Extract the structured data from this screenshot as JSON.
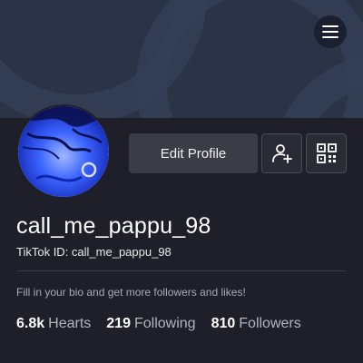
{
  "header": {
    "menu_icon": "hamburger-menu-icon"
  },
  "profile": {
    "avatar_icon": "profile-photo",
    "username": "call_me_pappu_98",
    "tiktok_id": "TikTok ID: call_me_pappu_98",
    "bio_prompt": "Fill in your bio and get more followers and likes!"
  },
  "actions": {
    "edit_profile_label": "Edit Profile",
    "add_friend_icon": "add-friend-icon",
    "qr_code_icon": "qr-code-icon"
  },
  "stats": [
    {
      "value": "6.8k",
      "label": "Hearts"
    },
    {
      "value": "219",
      "label": "Following"
    },
    {
      "value": "810",
      "label": "Followers"
    }
  ],
  "colors": {
    "background": "#1e1f29",
    "cover": "#2b3447",
    "button": "#3b3d46"
  }
}
